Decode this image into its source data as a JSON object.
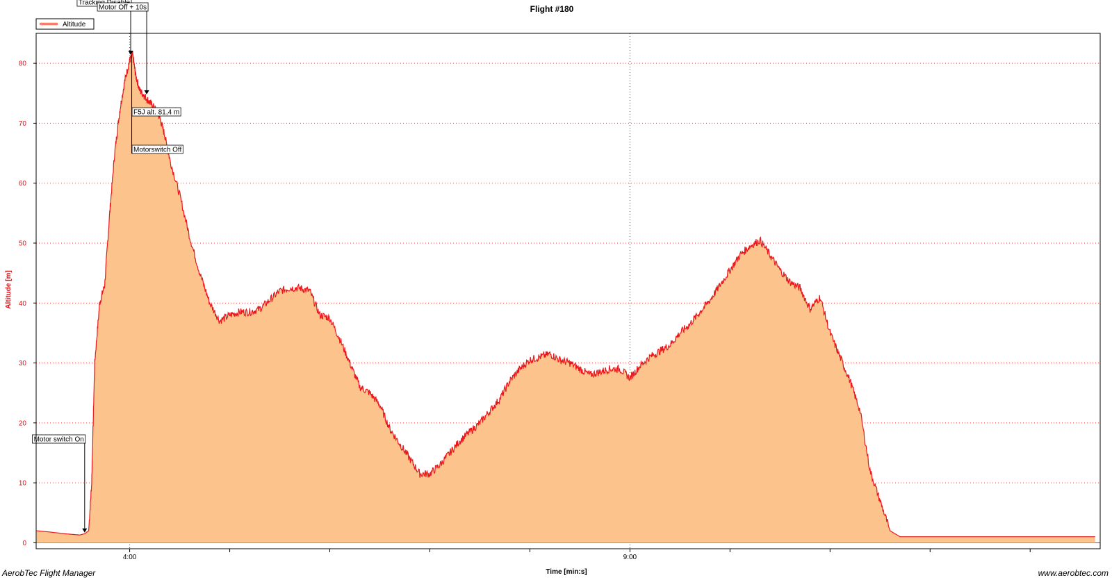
{
  "chart_data": {
    "type": "area",
    "title": "Flight #180",
    "xlabel": "Time [min:s]",
    "ylabel": "Altitude [m]",
    "x_unit": "min",
    "xlim": [
      3.065,
      13.7
    ],
    "ylim": [
      -1,
      85
    ],
    "x_ticks": [
      {
        "value": 4,
        "label": "4:00"
      },
      {
        "value": 9,
        "label": "9:00"
      }
    ],
    "y_ticks": [
      0,
      10,
      20,
      30,
      40,
      50,
      60,
      70,
      80
    ],
    "grid": true,
    "legend": {
      "position": "top-left",
      "entries": [
        "Altitude"
      ]
    },
    "series": [
      {
        "name": "Altitude",
        "line_color": "#e8181c",
        "fill_color": "#fcc48c",
        "x": [
          3.07,
          3.2,
          3.35,
          3.5,
          3.55,
          3.59,
          3.62,
          3.65,
          3.7,
          3.75,
          3.8,
          3.85,
          3.9,
          3.95,
          4.0,
          4.03,
          4.06,
          4.1,
          4.15,
          4.2,
          4.25,
          4.3,
          4.35,
          4.4,
          4.5,
          4.6,
          4.7,
          4.8,
          4.9,
          5.0,
          5.1,
          5.2,
          5.3,
          5.4,
          5.5,
          5.6,
          5.7,
          5.8,
          5.9,
          6.0,
          6.1,
          6.2,
          6.3,
          6.4,
          6.5,
          6.6,
          6.7,
          6.8,
          6.9,
          7.0,
          7.1,
          7.2,
          7.3,
          7.4,
          7.5,
          7.6,
          7.7,
          7.8,
          7.9,
          8.0,
          8.1,
          8.2,
          8.3,
          8.4,
          8.5,
          8.6,
          8.7,
          8.8,
          8.9,
          9.0,
          9.1,
          9.2,
          9.3,
          9.4,
          9.5,
          9.6,
          9.7,
          9.8,
          9.9,
          10.0,
          10.1,
          10.2,
          10.3,
          10.4,
          10.5,
          10.6,
          10.7,
          10.8,
          10.9,
          11.0,
          11.1,
          11.2,
          11.3,
          11.4,
          11.5,
          11.6,
          11.7,
          11.8,
          11.9,
          12.0,
          12.1,
          12.2,
          12.3,
          12.4,
          12.5,
          12.6,
          12.7,
          12.8,
          12.9,
          12.95,
          13.0,
          13.05,
          13.1,
          13.15,
          13.2,
          13.25,
          13.3,
          13.35,
          13.4,
          13.45,
          13.5,
          13.55,
          13.6,
          13.65
        ],
        "y": [
          2,
          1.8,
          1.5,
          1.3,
          1.5,
          2,
          10,
          30,
          40,
          43,
          55,
          65,
          72,
          77,
          80.5,
          81.4,
          78,
          75.5,
          74.5,
          73.5,
          72.5,
          71,
          68,
          64,
          58,
          51,
          45,
          40,
          37,
          38,
          38.5,
          38.5,
          39,
          40.5,
          42,
          42.5,
          42.5,
          42,
          38,
          37.5,
          34,
          30,
          26,
          25,
          23,
          19,
          16.5,
          14,
          11.5,
          11.5,
          13,
          15,
          17,
          18.5,
          20,
          22,
          24,
          27,
          29,
          30.5,
          31,
          31.5,
          30.5,
          30,
          29,
          28,
          28.5,
          29,
          29,
          27.5,
          29.5,
          31,
          32,
          33,
          35,
          36.5,
          38.5,
          40.5,
          43,
          45.5,
          48,
          49.5,
          50.5,
          48,
          45.5,
          43.5,
          42.5,
          39,
          41,
          35,
          31,
          27,
          22,
          12,
          7,
          2,
          1,
          1,
          1,
          1,
          1,
          1,
          1,
          1,
          1,
          1,
          1,
          1,
          1,
          1,
          1,
          1,
          1,
          1,
          1,
          1,
          1,
          1,
          1,
          1,
          1,
          1,
          1,
          1
        ]
      }
    ],
    "annotations": [
      {
        "label": "Motor switch On",
        "x": 3.55,
        "y": 1.7,
        "marker": true
      },
      {
        "label": "Tracking Disable",
        "x": 4.01,
        "y": 81.4,
        "marker": true
      },
      {
        "label": "Motor Off + 10s",
        "x": 4.17,
        "y": 74.8,
        "marker": true
      },
      {
        "label": "F5J alt. 81,4 m",
        "x": 4.01,
        "y": 81.4,
        "marker": false
      },
      {
        "label": "Motorswitch Off",
        "x": 4.01,
        "y": 81.4,
        "marker": false
      }
    ]
  },
  "footer": {
    "left": "AerobTec Flight Manager",
    "right": "www.aerobtec.com"
  }
}
